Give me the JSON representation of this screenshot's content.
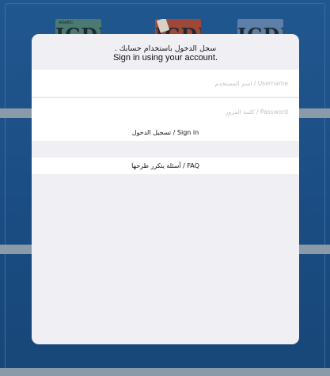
{
  "background": {
    "books": [
      {
        "title": "ICDL",
        "tag": "ARABIC"
      },
      {
        "title": "ICDL",
        "tag": ""
      },
      {
        "title": "ICDL",
        "tag": ""
      }
    ]
  },
  "login": {
    "header_ar": "سجل الدخول باستخدام حسابك .",
    "header_en": "Sign in using your account.",
    "username_placeholder": "اسم المستخدم / Username",
    "username_value": "",
    "password_placeholder": "كلمة المرور / Password",
    "password_value": "",
    "signin_label": "تسجيل الدخول / Sign in",
    "faq_label": "أسئلة يتكرر طرحها / FAQ"
  },
  "colors": {
    "background_blue": "#1c4d86",
    "sheet": "#efeff4",
    "row": "#ffffff",
    "placeholder": "#c2c2c8"
  }
}
